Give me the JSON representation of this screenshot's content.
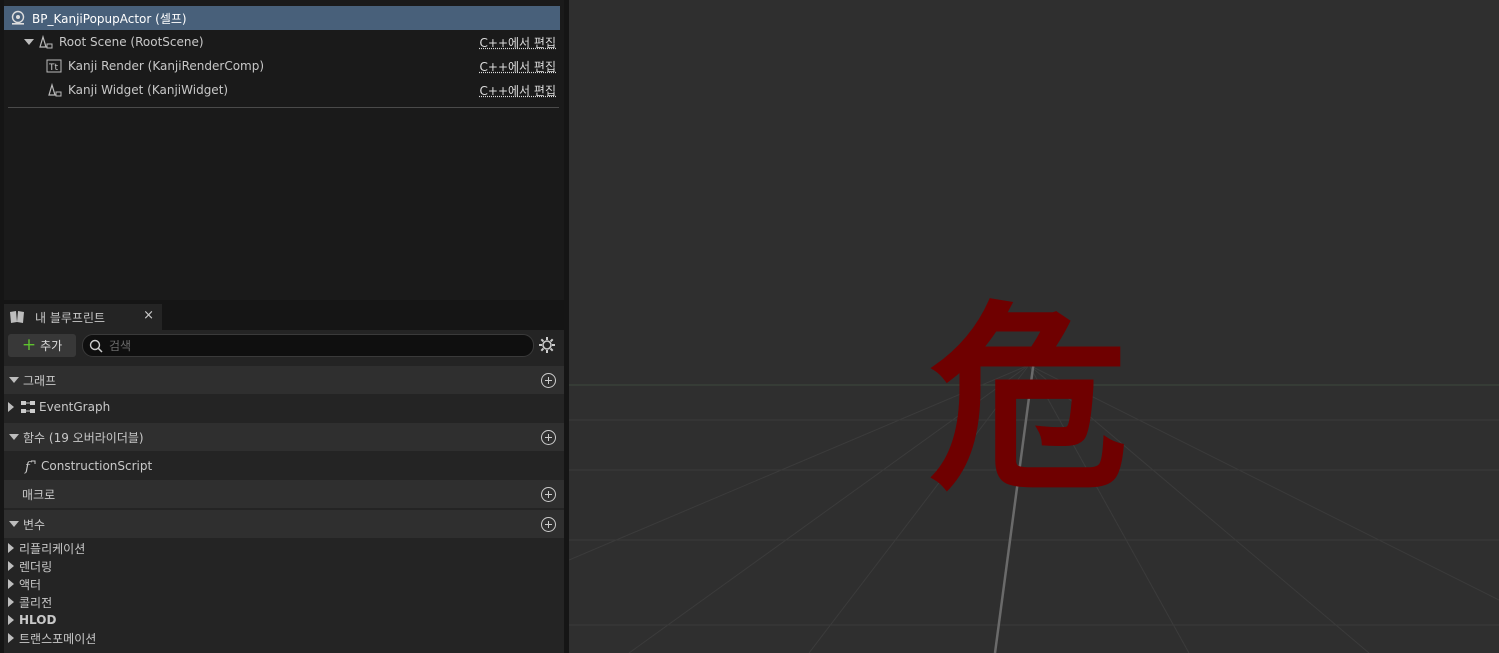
{
  "components": {
    "root_actor": "BP_KanjiPopupActor (셀프)",
    "items": [
      {
        "label": "Root Scene (RootScene)",
        "edit": "C++에서 편집"
      },
      {
        "label": "Kanji Render (KanjiRenderComp)",
        "edit": "C++에서 편집"
      },
      {
        "label": "Kanji Widget (KanjiWidget)",
        "edit": "C++에서 편집"
      }
    ]
  },
  "my_blueprint": {
    "tab_label": "내 블루프린트",
    "close": "×",
    "add_label": "추가",
    "search_placeholder": "검색",
    "sections": {
      "graphs": "그래프",
      "event_graph": "EventGraph",
      "functions": "함수 (19 오버라이더블)",
      "construction_script": "ConstructionScript",
      "macros": "매크로",
      "variables": "변수"
    },
    "categories": [
      "리플리케이션",
      "렌더링",
      "액터",
      "콜리전",
      "HLOD",
      "트랜스포메이션"
    ]
  },
  "viewport": {
    "kanji_color": "#6f0000",
    "grid_color": "#3b3b3b"
  }
}
